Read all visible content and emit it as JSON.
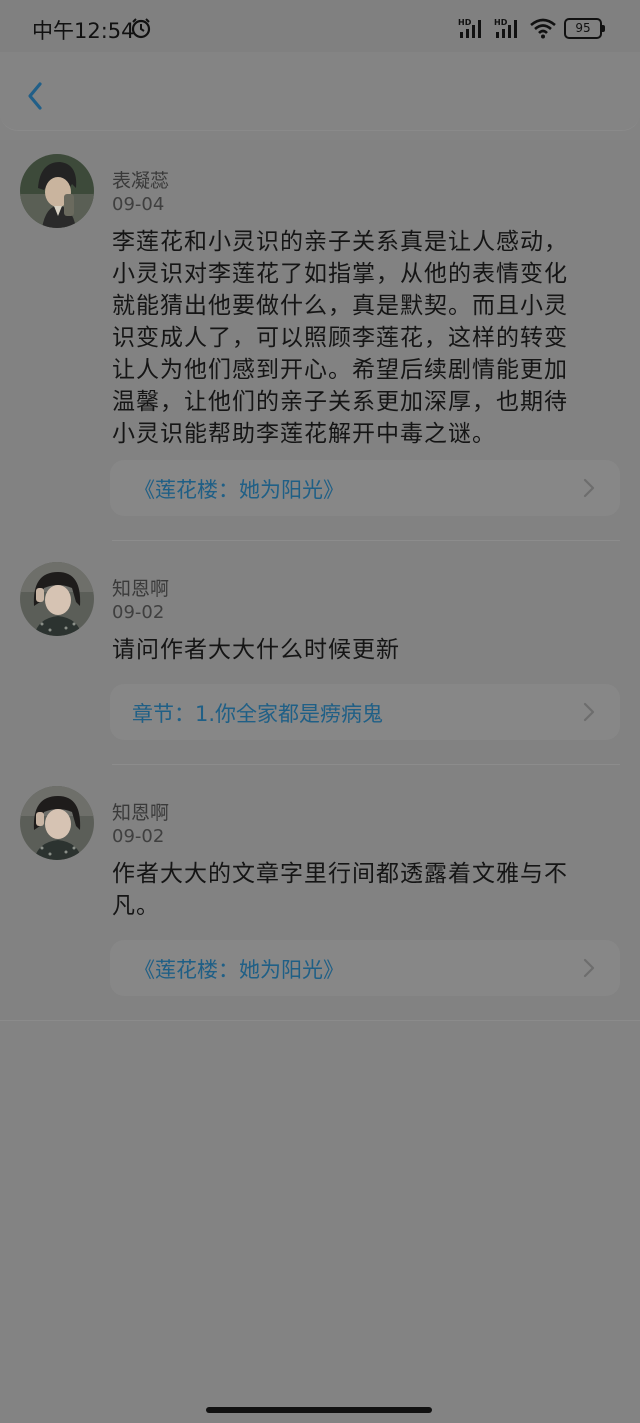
{
  "status_bar": {
    "time": "中午12:54",
    "battery": "95",
    "signal_label": "HD",
    "icons": [
      "alarm-icon",
      "signal-hd-icon",
      "signal-hd-icon",
      "wifi-icon",
      "battery-icon"
    ]
  },
  "header": {
    "back_icon": "chevron-left-icon"
  },
  "comments": [
    {
      "author": "表凝蕊",
      "date": "09-04",
      "lines": [
        "李莲花和小灵识的亲子关系真是让人感动，",
        "小灵识对李莲花了如指掌，从他的表情变化",
        "就能猜出他要做什么，真是默契。而且小灵",
        "识变成人了，可以照顾李莲花，这样的转变",
        "让人为他们感到开心。希望后续剧情能更加",
        "温馨，让他们的亲子关系更加深厚，也期待",
        "小灵识能帮助李莲花解开中毒之谜。"
      ],
      "link": "《莲花楼：她为阳光》"
    },
    {
      "author": "知恩啊",
      "date": "09-02",
      "lines": [
        "请问作者大大什么时候更新"
      ],
      "link": "章节：1.你全家都是痨病鬼"
    },
    {
      "author": "知恩啊",
      "date": "09-02",
      "lines": [
        "作者大大的文章字里行间都透露着文雅与不",
        "凡。"
      ],
      "link": "《莲花楼：她为阳光》"
    }
  ],
  "colors": {
    "link": "#1f5f86",
    "overlay_background": "#838383"
  }
}
